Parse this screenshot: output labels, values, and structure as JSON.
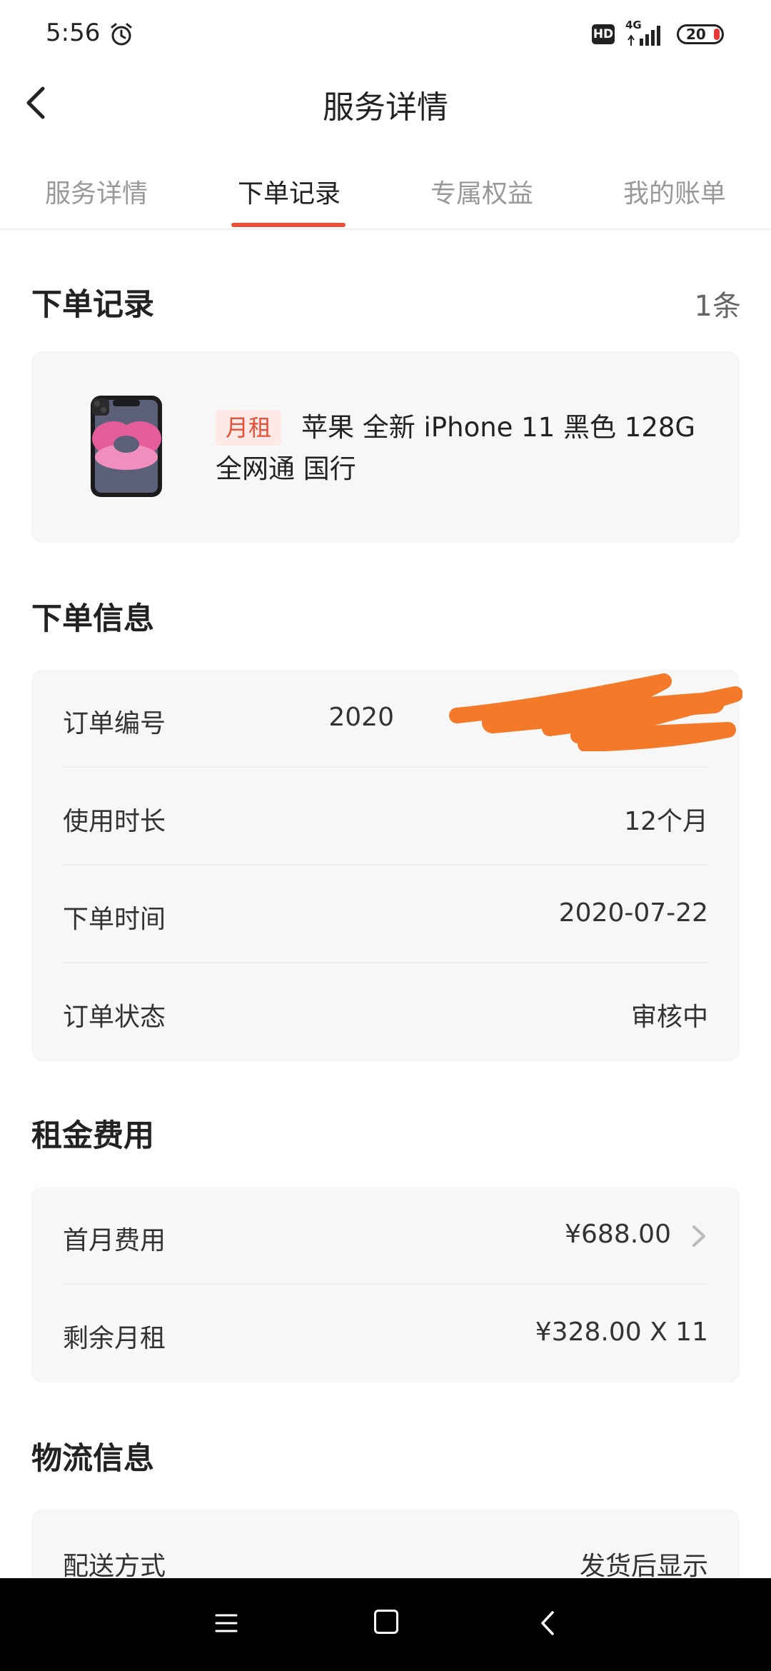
{
  "status_bar": {
    "time": "5:56",
    "network": "4G",
    "battery": "20",
    "hd_label": "HD"
  },
  "header": {
    "title": "服务详情"
  },
  "tabs": [
    {
      "label": "服务详情",
      "active": false
    },
    {
      "label": "下单记录",
      "active": true
    },
    {
      "label": "专属权益",
      "active": false
    },
    {
      "label": "我的账单",
      "active": false
    }
  ],
  "order_records": {
    "title": "下单记录",
    "count": "1条",
    "product": {
      "tag": "月租",
      "name": "苹果 全新 iPhone 11 黑色 128G 全网通 国行"
    }
  },
  "order_info": {
    "title": "下单信息",
    "rows": [
      {
        "label": "订单编号",
        "value": "2020"
      },
      {
        "label": "使用时长",
        "value": "12个月"
      },
      {
        "label": "下单时间",
        "value": "2020-07-22"
      },
      {
        "label": "订单状态",
        "value": "审核中"
      }
    ]
  },
  "rent_fees": {
    "title": "租金费用",
    "rows": [
      {
        "label": "首月费用",
        "value": "¥688.00"
      },
      {
        "label": "剩余月租",
        "value": "¥328.00 X 11"
      }
    ]
  },
  "logistics": {
    "title": "物流信息",
    "rows": [
      {
        "label": "配送方式",
        "value": "发货后显示"
      }
    ]
  },
  "colors": {
    "accent": "#e8503a",
    "redaction": "#f47a2a",
    "card_bg": "#f7f7f7"
  },
  "icons": [
    "alarm-icon",
    "back-icon",
    "chevron-right-icon",
    "menu-icon",
    "home-icon",
    "back-nav-icon"
  ]
}
